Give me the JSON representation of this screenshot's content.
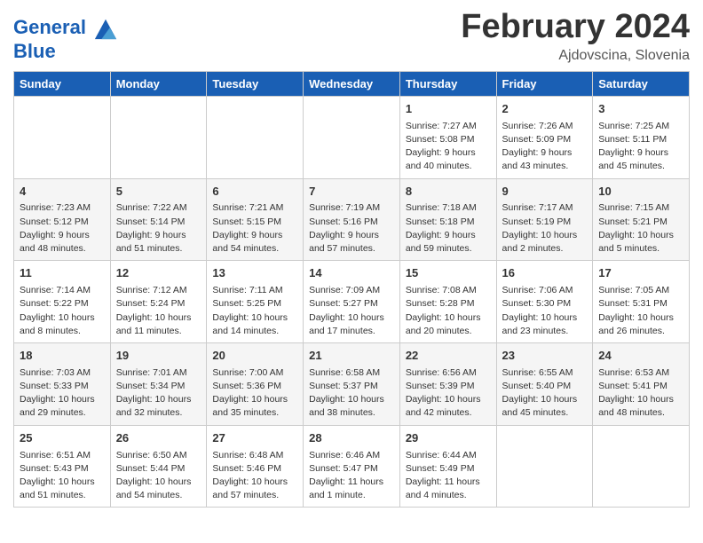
{
  "header": {
    "logo_line1": "General",
    "logo_line2": "Blue",
    "month": "February 2024",
    "location": "Ajdovscina, Slovenia"
  },
  "weekdays": [
    "Sunday",
    "Monday",
    "Tuesday",
    "Wednesday",
    "Thursday",
    "Friday",
    "Saturday"
  ],
  "weeks": [
    [
      {
        "day": "",
        "info": ""
      },
      {
        "day": "",
        "info": ""
      },
      {
        "day": "",
        "info": ""
      },
      {
        "day": "",
        "info": ""
      },
      {
        "day": "1",
        "info": "Sunrise: 7:27 AM\nSunset: 5:08 PM\nDaylight: 9 hours\nand 40 minutes."
      },
      {
        "day": "2",
        "info": "Sunrise: 7:26 AM\nSunset: 5:09 PM\nDaylight: 9 hours\nand 43 minutes."
      },
      {
        "day": "3",
        "info": "Sunrise: 7:25 AM\nSunset: 5:11 PM\nDaylight: 9 hours\nand 45 minutes."
      }
    ],
    [
      {
        "day": "4",
        "info": "Sunrise: 7:23 AM\nSunset: 5:12 PM\nDaylight: 9 hours\nand 48 minutes."
      },
      {
        "day": "5",
        "info": "Sunrise: 7:22 AM\nSunset: 5:14 PM\nDaylight: 9 hours\nand 51 minutes."
      },
      {
        "day": "6",
        "info": "Sunrise: 7:21 AM\nSunset: 5:15 PM\nDaylight: 9 hours\nand 54 minutes."
      },
      {
        "day": "7",
        "info": "Sunrise: 7:19 AM\nSunset: 5:16 PM\nDaylight: 9 hours\nand 57 minutes."
      },
      {
        "day": "8",
        "info": "Sunrise: 7:18 AM\nSunset: 5:18 PM\nDaylight: 9 hours\nand 59 minutes."
      },
      {
        "day": "9",
        "info": "Sunrise: 7:17 AM\nSunset: 5:19 PM\nDaylight: 10 hours\nand 2 minutes."
      },
      {
        "day": "10",
        "info": "Sunrise: 7:15 AM\nSunset: 5:21 PM\nDaylight: 10 hours\nand 5 minutes."
      }
    ],
    [
      {
        "day": "11",
        "info": "Sunrise: 7:14 AM\nSunset: 5:22 PM\nDaylight: 10 hours\nand 8 minutes."
      },
      {
        "day": "12",
        "info": "Sunrise: 7:12 AM\nSunset: 5:24 PM\nDaylight: 10 hours\nand 11 minutes."
      },
      {
        "day": "13",
        "info": "Sunrise: 7:11 AM\nSunset: 5:25 PM\nDaylight: 10 hours\nand 14 minutes."
      },
      {
        "day": "14",
        "info": "Sunrise: 7:09 AM\nSunset: 5:27 PM\nDaylight: 10 hours\nand 17 minutes."
      },
      {
        "day": "15",
        "info": "Sunrise: 7:08 AM\nSunset: 5:28 PM\nDaylight: 10 hours\nand 20 minutes."
      },
      {
        "day": "16",
        "info": "Sunrise: 7:06 AM\nSunset: 5:30 PM\nDaylight: 10 hours\nand 23 minutes."
      },
      {
        "day": "17",
        "info": "Sunrise: 7:05 AM\nSunset: 5:31 PM\nDaylight: 10 hours\nand 26 minutes."
      }
    ],
    [
      {
        "day": "18",
        "info": "Sunrise: 7:03 AM\nSunset: 5:33 PM\nDaylight: 10 hours\nand 29 minutes."
      },
      {
        "day": "19",
        "info": "Sunrise: 7:01 AM\nSunset: 5:34 PM\nDaylight: 10 hours\nand 32 minutes."
      },
      {
        "day": "20",
        "info": "Sunrise: 7:00 AM\nSunset: 5:36 PM\nDaylight: 10 hours\nand 35 minutes."
      },
      {
        "day": "21",
        "info": "Sunrise: 6:58 AM\nSunset: 5:37 PM\nDaylight: 10 hours\nand 38 minutes."
      },
      {
        "day": "22",
        "info": "Sunrise: 6:56 AM\nSunset: 5:39 PM\nDaylight: 10 hours\nand 42 minutes."
      },
      {
        "day": "23",
        "info": "Sunrise: 6:55 AM\nSunset: 5:40 PM\nDaylight: 10 hours\nand 45 minutes."
      },
      {
        "day": "24",
        "info": "Sunrise: 6:53 AM\nSunset: 5:41 PM\nDaylight: 10 hours\nand 48 minutes."
      }
    ],
    [
      {
        "day": "25",
        "info": "Sunrise: 6:51 AM\nSunset: 5:43 PM\nDaylight: 10 hours\nand 51 minutes."
      },
      {
        "day": "26",
        "info": "Sunrise: 6:50 AM\nSunset: 5:44 PM\nDaylight: 10 hours\nand 54 minutes."
      },
      {
        "day": "27",
        "info": "Sunrise: 6:48 AM\nSunset: 5:46 PM\nDaylight: 10 hours\nand 57 minutes."
      },
      {
        "day": "28",
        "info": "Sunrise: 6:46 AM\nSunset: 5:47 PM\nDaylight: 11 hours\nand 1 minute."
      },
      {
        "day": "29",
        "info": "Sunrise: 6:44 AM\nSunset: 5:49 PM\nDaylight: 11 hours\nand 4 minutes."
      },
      {
        "day": "",
        "info": ""
      },
      {
        "day": "",
        "info": ""
      }
    ]
  ]
}
